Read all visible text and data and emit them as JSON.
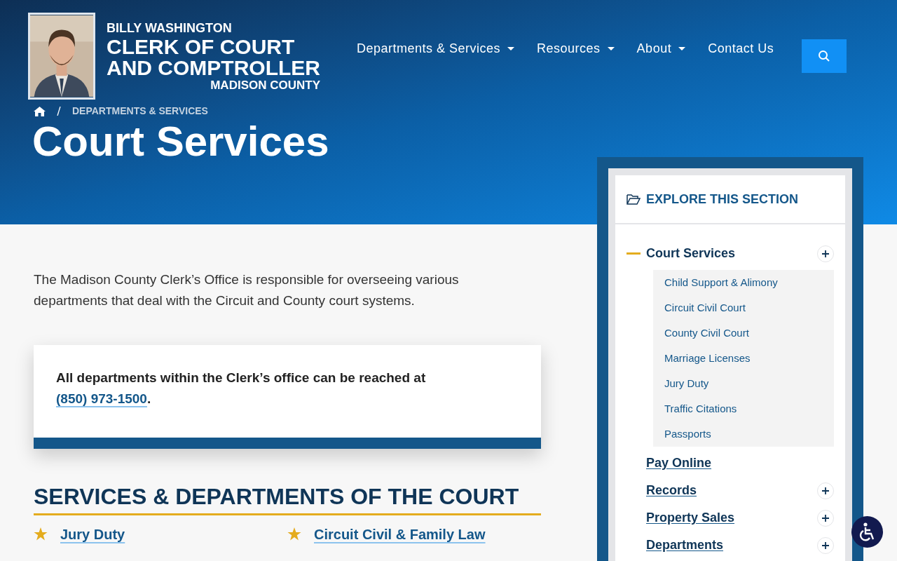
{
  "logo": {
    "name": "BILLY WASHINGTON",
    "title_line_1": "CLERK OF COURT",
    "title_line_2": "AND COMPTROLLER",
    "county": "MADISON COUNTY"
  },
  "nav": [
    {
      "label": "Departments & Services",
      "dropdown": true
    },
    {
      "label": "Resources",
      "dropdown": true
    },
    {
      "label": "About",
      "dropdown": true
    },
    {
      "label": "Contact Us",
      "dropdown": false
    }
  ],
  "breadcrumb": [
    "DEPARTMENTS & SERVICES"
  ],
  "page_title": "Court Services",
  "intro": "The Madison County Clerk’s Office is responsible for overseeing various departments that deal with the Circuit and County court systems.",
  "callout": {
    "text": "All departments within the Clerk’s office can be reached at ",
    "phone": "(850) 973-1500",
    "end": "."
  },
  "section_heading": "SERVICES & DEPARTMENTS OF THE COURT",
  "services": [
    {
      "label": "Jury Duty"
    },
    {
      "label": "Circuit Civil & Family Law"
    }
  ],
  "sidebar": {
    "heading": "EXPLORE THIS SECTION",
    "items": [
      {
        "label": "Court Services",
        "selected": true,
        "toggle": true,
        "children": [
          {
            "label": "Child Support & Alimony"
          },
          {
            "label": "Circuit Civil Court"
          },
          {
            "label": "County Civil Court"
          },
          {
            "label": "Marriage Licenses"
          },
          {
            "label": "Jury Duty"
          },
          {
            "label": "Traffic Citations"
          },
          {
            "label": "Passports"
          }
        ]
      },
      {
        "label": "Pay Online",
        "selected": false,
        "toggle": false
      },
      {
        "label": "Records",
        "selected": false,
        "toggle": true
      },
      {
        "label": "Property Sales",
        "selected": false,
        "toggle": true
      },
      {
        "label": "Departments",
        "selected": false,
        "toggle": true
      }
    ]
  }
}
